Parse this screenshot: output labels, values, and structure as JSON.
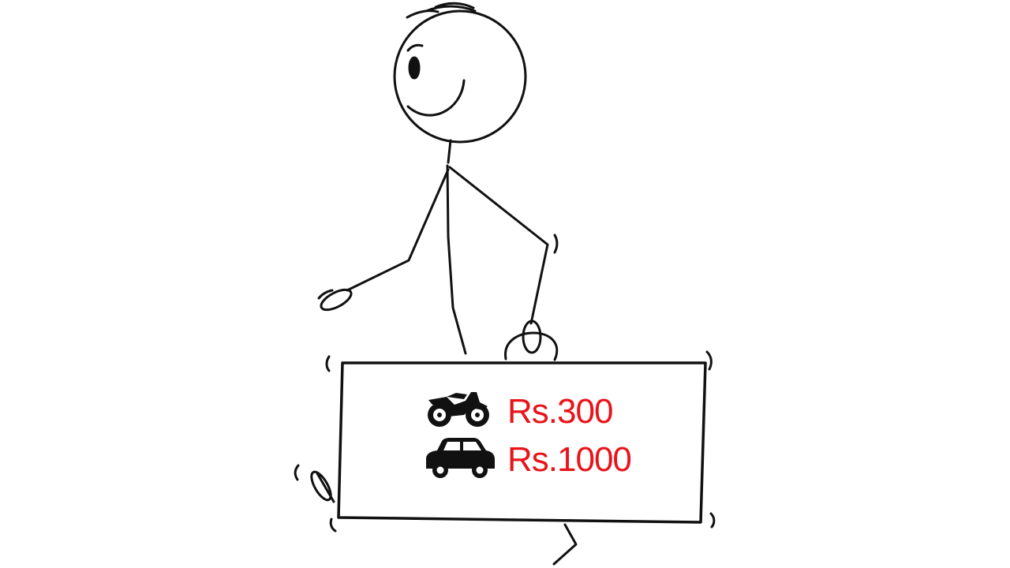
{
  "sign": {
    "rows": [
      {
        "icon": "motorcycle-icon",
        "price": "Rs.300"
      },
      {
        "icon": "car-icon",
        "price": "Rs.1000"
      }
    ]
  },
  "colors": {
    "ink": "#111111",
    "price_text": "#e8141a",
    "background": "#ffffff"
  }
}
